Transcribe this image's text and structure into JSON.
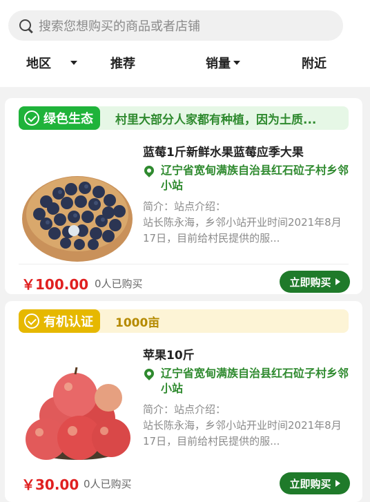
{
  "search": {
    "placeholder": "搜索您想购买的商品或者店铺",
    "icon": "search-icon"
  },
  "filters": [
    {
      "label": "地区",
      "dropdown": true
    },
    {
      "label": "推荐",
      "dropdown": false
    },
    {
      "label": "销量",
      "dropdown": true
    },
    {
      "label": "附近",
      "dropdown": false
    }
  ],
  "products": [
    {
      "tag": "绿色生态",
      "tag_color": "#1fb33a",
      "tag_bg": "#e6f7e6",
      "tag_desc": "村里大部分人家都有种植，因为土质...",
      "tag_desc_color": "#2f8a2f",
      "title": "蓝莓1斤新鲜水果蓝莓应季大果",
      "location": "辽宁省宽甸满族自治县红石砬子村乡邻小站",
      "intro_label": "简介：站点介绍：",
      "intro_text": "站长陈永海，乡邻小站开业时间2021年8月17日，目前给村民提供的服...",
      "price": "￥100.00",
      "sold": "0人已购买",
      "buy": "立即购买",
      "image": "blueberries"
    },
    {
      "tag": "有机认证",
      "tag_color": "#e6b800",
      "tag_bg": "#fdf4d6",
      "tag_desc": "1000亩",
      "tag_desc_color": "#b58a00",
      "title": "苹果10斤",
      "location": "辽宁省宽甸满族自治县红石砬子村乡邻小站",
      "intro_label": "简介：站点介绍：",
      "intro_text": "站长陈永海，乡邻小站开业时间2021年8月17日，目前给村民提供的服...",
      "price": "￥30.00",
      "sold": "0人已购买",
      "buy": "立即购买",
      "image": "apples"
    }
  ]
}
